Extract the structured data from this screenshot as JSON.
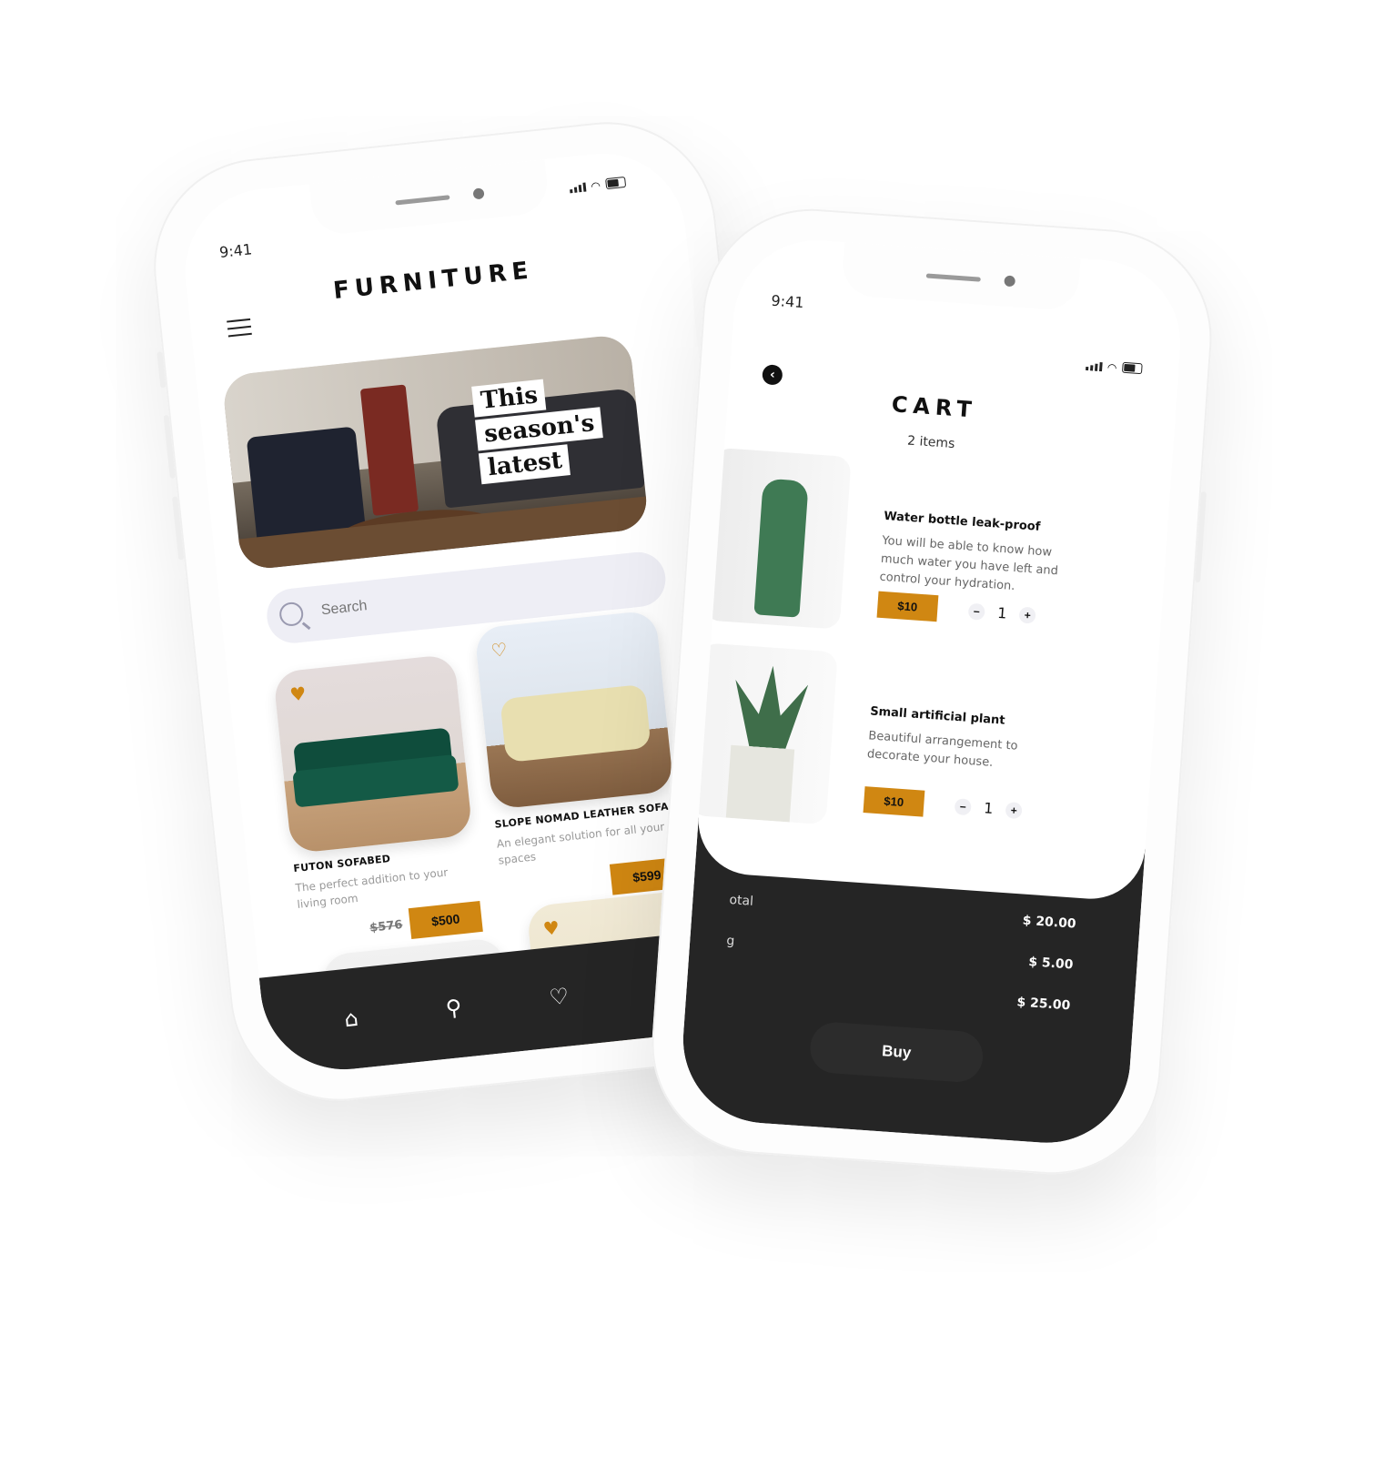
{
  "status": {
    "time": "9:41"
  },
  "home": {
    "title": "FURNITURE",
    "hero_lines": [
      "This",
      "season's",
      "latest"
    ],
    "search_placeholder": "Search",
    "products": [
      {
        "name": "FUTON SOFABED",
        "desc": "The perfect addition to your living room",
        "old_price": "$576",
        "price": "$500",
        "favorited": true
      },
      {
        "name": "SLOPE NOMAD LEATHER SOFA",
        "desc": "An elegant solution for all your spaces",
        "old_price": "",
        "price": "$599",
        "favorited": false
      },
      {
        "name": "",
        "desc": "",
        "price": "",
        "favorited": false
      },
      {
        "name": "",
        "desc": "",
        "price": "",
        "favorited": true
      }
    ],
    "nav": [
      {
        "icon": "home-icon"
      },
      {
        "icon": "search-icon"
      },
      {
        "icon": "heart-icon"
      },
      {
        "icon": "cart-icon"
      }
    ]
  },
  "cart": {
    "title": "CART",
    "count_label": "2 items",
    "items": [
      {
        "name": "Water bottle leak-proof",
        "desc": "You will be able to know how much water you have left and control your hydration.",
        "price": "$10",
        "qty": "1"
      },
      {
        "name": "Small artificial plant",
        "desc": "Beautiful arrangement to decorate your house.",
        "price": "$10",
        "qty": "1"
      }
    ],
    "summary": [
      {
        "label": "otal",
        "value": "$ 20.00"
      },
      {
        "label": "g",
        "value": "$ 5.00"
      },
      {
        "label": "",
        "value": "$ 25.00"
      }
    ],
    "buy_label": "Buy"
  },
  "colors": {
    "accent": "#d08712",
    "dark": "#252525",
    "search_bg": "#eeeef5"
  }
}
